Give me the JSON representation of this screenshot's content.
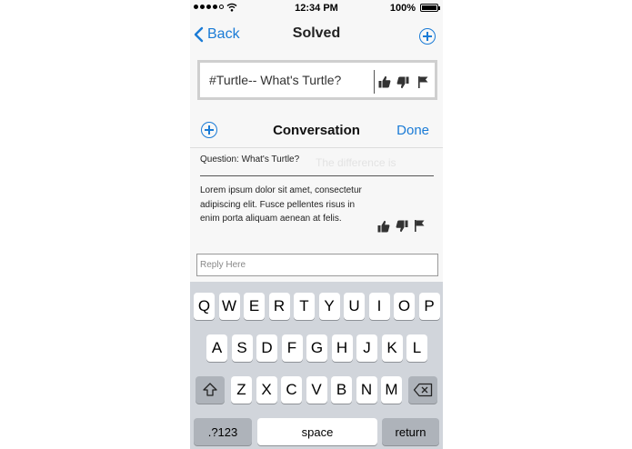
{
  "status": {
    "time": "12:34 PM",
    "battery": "100%",
    "battery_level": 1.0
  },
  "nav": {
    "back_label": "Back",
    "title": "Solved"
  },
  "question_card": {
    "text": "#Turtle-- What's Turtle?"
  },
  "conversation": {
    "title": "Conversation",
    "done_label": "Done",
    "faded_text": "The difference is",
    "question": "Question: What's Turtle?",
    "answer": "Lorem ipsum dolor sit amet, consectetur adipiscing elit. Fusce pellentes risus in enim porta aliquam aenean at felis."
  },
  "reply": {
    "placeholder": "Reply Here"
  },
  "keyboard": {
    "row1": [
      "Q",
      "W",
      "E",
      "R",
      "T",
      "Y",
      "U",
      "I",
      "O",
      "P"
    ],
    "row2": [
      "A",
      "S",
      "D",
      "F",
      "G",
      "H",
      "J",
      "K",
      "L"
    ],
    "row3": [
      "Z",
      "X",
      "C",
      "V",
      "B",
      "N",
      "M"
    ],
    "numbers_label": ".?123",
    "space_label": "space",
    "return_label": "return"
  },
  "icons": [
    "wifi-icon",
    "battery-icon",
    "chevron-left-icon",
    "plus-icon",
    "thumbs-up-icon",
    "thumbs-down-icon",
    "flag-icon",
    "shift-icon",
    "delete-icon"
  ],
  "colors": {
    "accent": "#1a7bd6",
    "keyboard_bg": "#d1d5db",
    "key": "#ffffff",
    "key_dark": "#aeb3ba"
  }
}
